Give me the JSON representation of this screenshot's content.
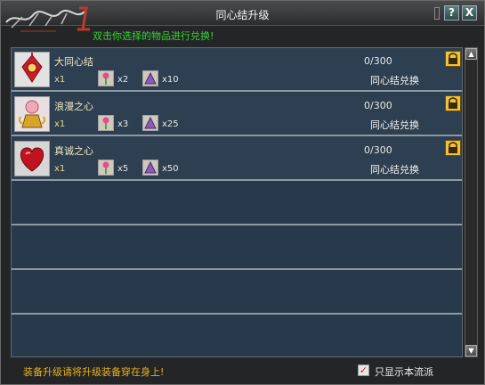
{
  "window": {
    "title": "同心结升级",
    "help_label": "?",
    "close_label": "X",
    "hint": "双击你选择的物品进行兑换!"
  },
  "items": [
    {
      "name": "大同心结",
      "quantity": "x1",
      "material_a_qty": "x2",
      "material_b_qty": "x10",
      "progress": "0/300",
      "exchange_label": "同心结兑换"
    },
    {
      "name": "浪漫之心",
      "quantity": "x1",
      "material_a_qty": "x3",
      "material_b_qty": "x25",
      "progress": "0/300",
      "exchange_label": "同心结兑换"
    },
    {
      "name": "真诚之心",
      "quantity": "x1",
      "material_a_qty": "x5",
      "material_b_qty": "x50",
      "progress": "0/300",
      "exchange_label": "同心结兑换"
    }
  ],
  "footer": {
    "hint": "装备升级请将升级装备穿在身上!",
    "checkbox_label": "只显示本流派",
    "checkbox_mark": "✓"
  },
  "colors": {
    "hint_green": "#38d438",
    "footer_gold": "#e6b21f",
    "list_background": "#27394a"
  }
}
